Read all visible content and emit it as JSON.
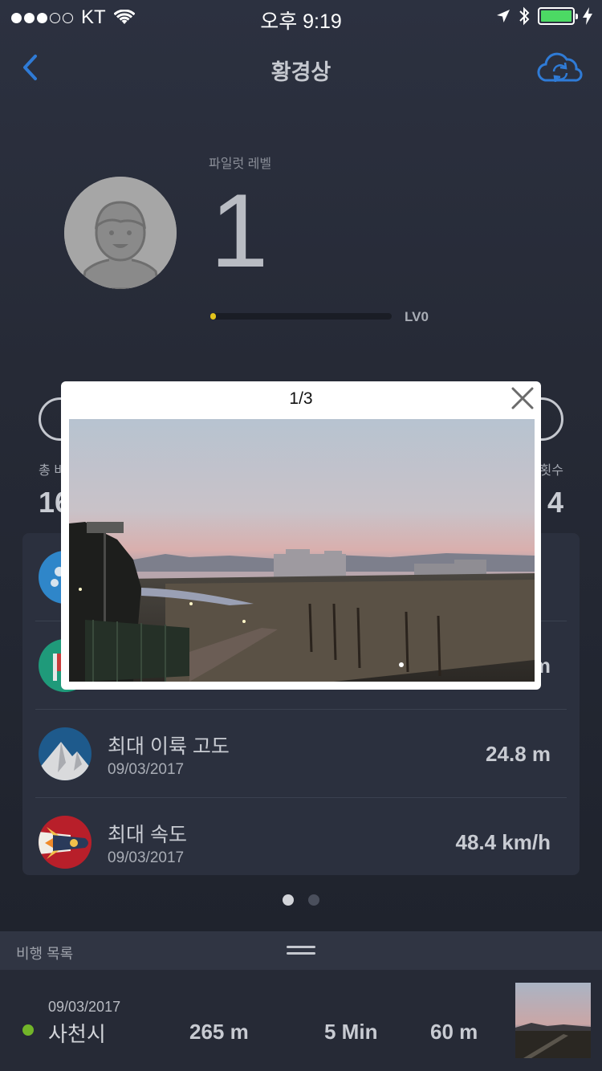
{
  "status_bar": {
    "carrier": "KT",
    "time": "오후 9:19"
  },
  "nav": {
    "title": "황경상",
    "back_icon": "chevron-left-icon",
    "sync_icon": "cloud-sync-icon"
  },
  "profile": {
    "level_label": "파일럿 레벨",
    "level": "1",
    "progress_label": "LV0",
    "progress_fraction": 0.02
  },
  "stats": {
    "left_label": "총 비",
    "left_value": "16",
    "right_label": "횟수",
    "right_value": "4"
  },
  "records": [
    {
      "title": "",
      "date": "",
      "value": "",
      "icon": "drone-icon"
    },
    {
      "title": "",
      "date": "",
      "value": "m",
      "icon": "flag-icon"
    },
    {
      "title": "최대 이륙 고도",
      "date": "09/03/2017",
      "value": "24.8 m",
      "icon": "mountain-icon"
    },
    {
      "title": "최대 속도",
      "date": "09/03/2017",
      "value": "48.4 km/h",
      "icon": "rocket-icon"
    }
  ],
  "pager": {
    "pages": 2,
    "active": 0
  },
  "flight_list": {
    "header": "비행 목록",
    "items": [
      {
        "date": "09/03/2017",
        "place": "사천시",
        "distance": "265 m",
        "duration": "5 Min",
        "altitude": "60 m",
        "status_color": "#72b529"
      }
    ]
  },
  "modal": {
    "counter": "1/3",
    "close_icon": "close-icon"
  },
  "colors": {
    "accent": "#2f7bd6",
    "progress": "#e3c41b",
    "battery": "#4cd964"
  }
}
